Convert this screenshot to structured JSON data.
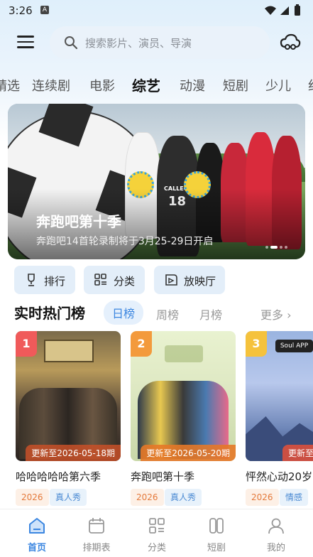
{
  "status_bar": {
    "time": "3:26",
    "notif": "A"
  },
  "header": {
    "search_placeholder": "搜索影片、演员、导演"
  },
  "categories": [
    "精选",
    "连续剧",
    "电影",
    "综艺",
    "动漫",
    "短剧",
    "少儿",
    "纪"
  ],
  "active_category": "综艺",
  "banner": {
    "title": "奔跑吧第十季",
    "subtitle": "奔跑吧14首轮录制将于3月25-29日开启",
    "poster_number": "18",
    "poster_word": "CALLEO"
  },
  "quick_buttons": [
    {
      "label": "排行",
      "icon": "ranking-icon"
    },
    {
      "label": "分类",
      "icon": "category-icon"
    },
    {
      "label": "放映厅",
      "icon": "theater-icon"
    }
  ],
  "ranking": {
    "title": "实时热门榜",
    "tabs": [
      "日榜",
      "周榜",
      "月榜"
    ],
    "active_tab": "日榜",
    "more": "更多 ›"
  },
  "cards": [
    {
      "rank": "1",
      "update": "更新至2026-05-18期",
      "title": "哈哈哈哈哈第六季",
      "year": "2026",
      "genre": "真人秀",
      "badge_color": "#f05a5a"
    },
    {
      "rank": "2",
      "update": "更新至2026-05-20期",
      "title": "奔跑吧第十季",
      "year": "2026",
      "genre": "真人秀",
      "badge_color": "#f39a3c"
    },
    {
      "rank": "3",
      "update": "更新至",
      "title": "怦然心动20岁",
      "year": "2026",
      "genre": "情感",
      "badge_color": "#f5c23c"
    }
  ],
  "bottom_nav": [
    {
      "label": "首页",
      "icon": "home-icon",
      "active": true
    },
    {
      "label": "排期表",
      "icon": "calendar-icon",
      "active": false
    },
    {
      "label": "分类",
      "icon": "category-icon",
      "active": false
    },
    {
      "label": "短剧",
      "icon": "short-drama-icon",
      "active": false
    },
    {
      "label": "我的",
      "icon": "profile-icon",
      "active": false
    }
  ]
}
